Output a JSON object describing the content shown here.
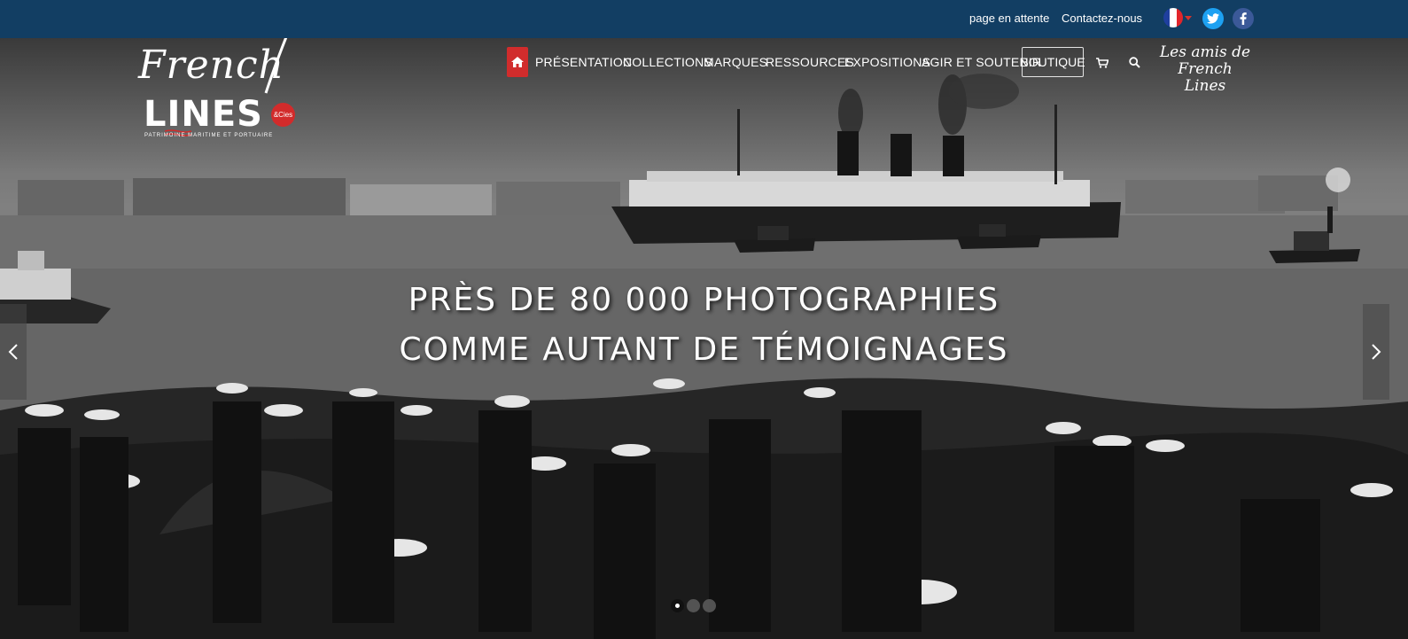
{
  "topbar": {
    "pending_link": "page en attente",
    "contact_link": "Contactez-nous",
    "language_flag": "france-flag-icon",
    "social": [
      {
        "icon": "twitter-icon",
        "color": "#1da1f2"
      },
      {
        "icon": "facebook-icon",
        "color": "#3b5998"
      }
    ],
    "background": "#123e63"
  },
  "logo": {
    "script": "French",
    "lines": "LINES",
    "badge": "&Cies",
    "tagline": "PATRIMOINE MARITIME ET PORTUAIRE"
  },
  "nav": {
    "home_icon": "home-icon",
    "items": [
      "PRÉSENTATION",
      "COLLECTIONS",
      "MARQUES",
      "RESSOURCES",
      "EXPOSITIONS",
      "AGIR ET SOUTENIR"
    ],
    "boutique": "BOUTIQUE",
    "cart_icon": "cart-icon",
    "search_icon": "search-icon",
    "amis_line1": "Les amis de",
    "amis_line2": "French Lines",
    "accent": "#d12c2c"
  },
  "hero": {
    "caption_line1": "PRÈS DE 80 000 PHOTOGRAPHIES",
    "caption_line2": "COMME AUTANT DE TÉMOIGNAGES",
    "prev_icon": "chevron-left-icon",
    "next_icon": "chevron-right-icon",
    "slides_count": 3,
    "active_slide": 1
  }
}
